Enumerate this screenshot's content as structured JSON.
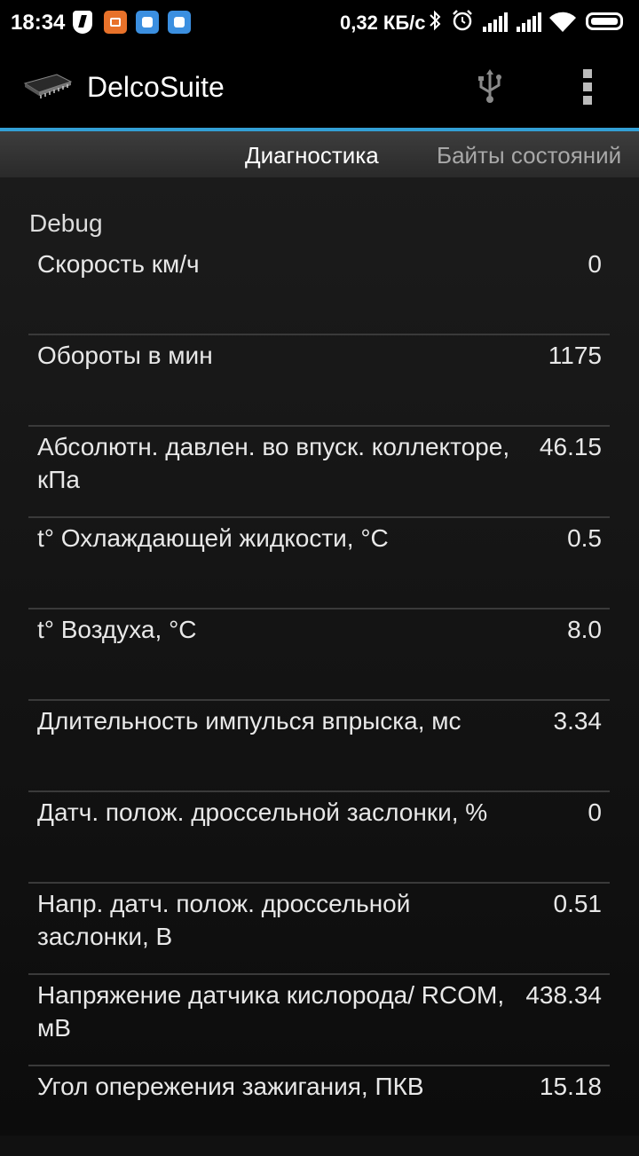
{
  "status_bar": {
    "time": "18:34",
    "data_rate": "0,32 КБ/с",
    "icons": [
      "shield-icon",
      "app-notification-icon",
      "app-notification-icon",
      "app-notification-icon",
      "bluetooth-icon",
      "alarm-icon",
      "signal-icon",
      "signal-icon",
      "wifi-icon",
      "battery-icon"
    ]
  },
  "action_bar": {
    "title": "DelcoSuite",
    "icons": [
      "chip-icon",
      "usb-icon",
      "overflow-menu-icon"
    ]
  },
  "tabs": [
    {
      "label": "Диагностика",
      "active": true
    },
    {
      "label": "Байты состояний",
      "active": false
    }
  ],
  "section": {
    "title": "Debug"
  },
  "rows": [
    {
      "label": "Скорость км/ч",
      "value": "0"
    },
    {
      "label": "Обороты в мин",
      "value": "1175"
    },
    {
      "label": "Абсолютн. давлен. во впуск. коллекторе, кПа",
      "value": "46.15"
    },
    {
      "label": "t° Охлаждающей жидкости, °C",
      "value": "0.5"
    },
    {
      "label": "t° Воздуха, °C",
      "value": "8.0"
    },
    {
      "label": "Длительность импулься впрыска, мс",
      "value": "3.34"
    },
    {
      "label": "Датч. полож. дроссельной заслонки, %",
      "value": "0"
    },
    {
      "label": "Напр. датч. полож. дроссельной заслонки, В",
      "value": "0.51"
    },
    {
      "label": "Напряжение датчика кислорода/ RCOM, мВ",
      "value": "438.34"
    },
    {
      "label": "Угол опережения зажигания, ПКВ",
      "value": "15.18"
    }
  ],
  "colors": {
    "accent": "#33a0d6",
    "background": "#111111",
    "text": "#e8e8e8"
  }
}
